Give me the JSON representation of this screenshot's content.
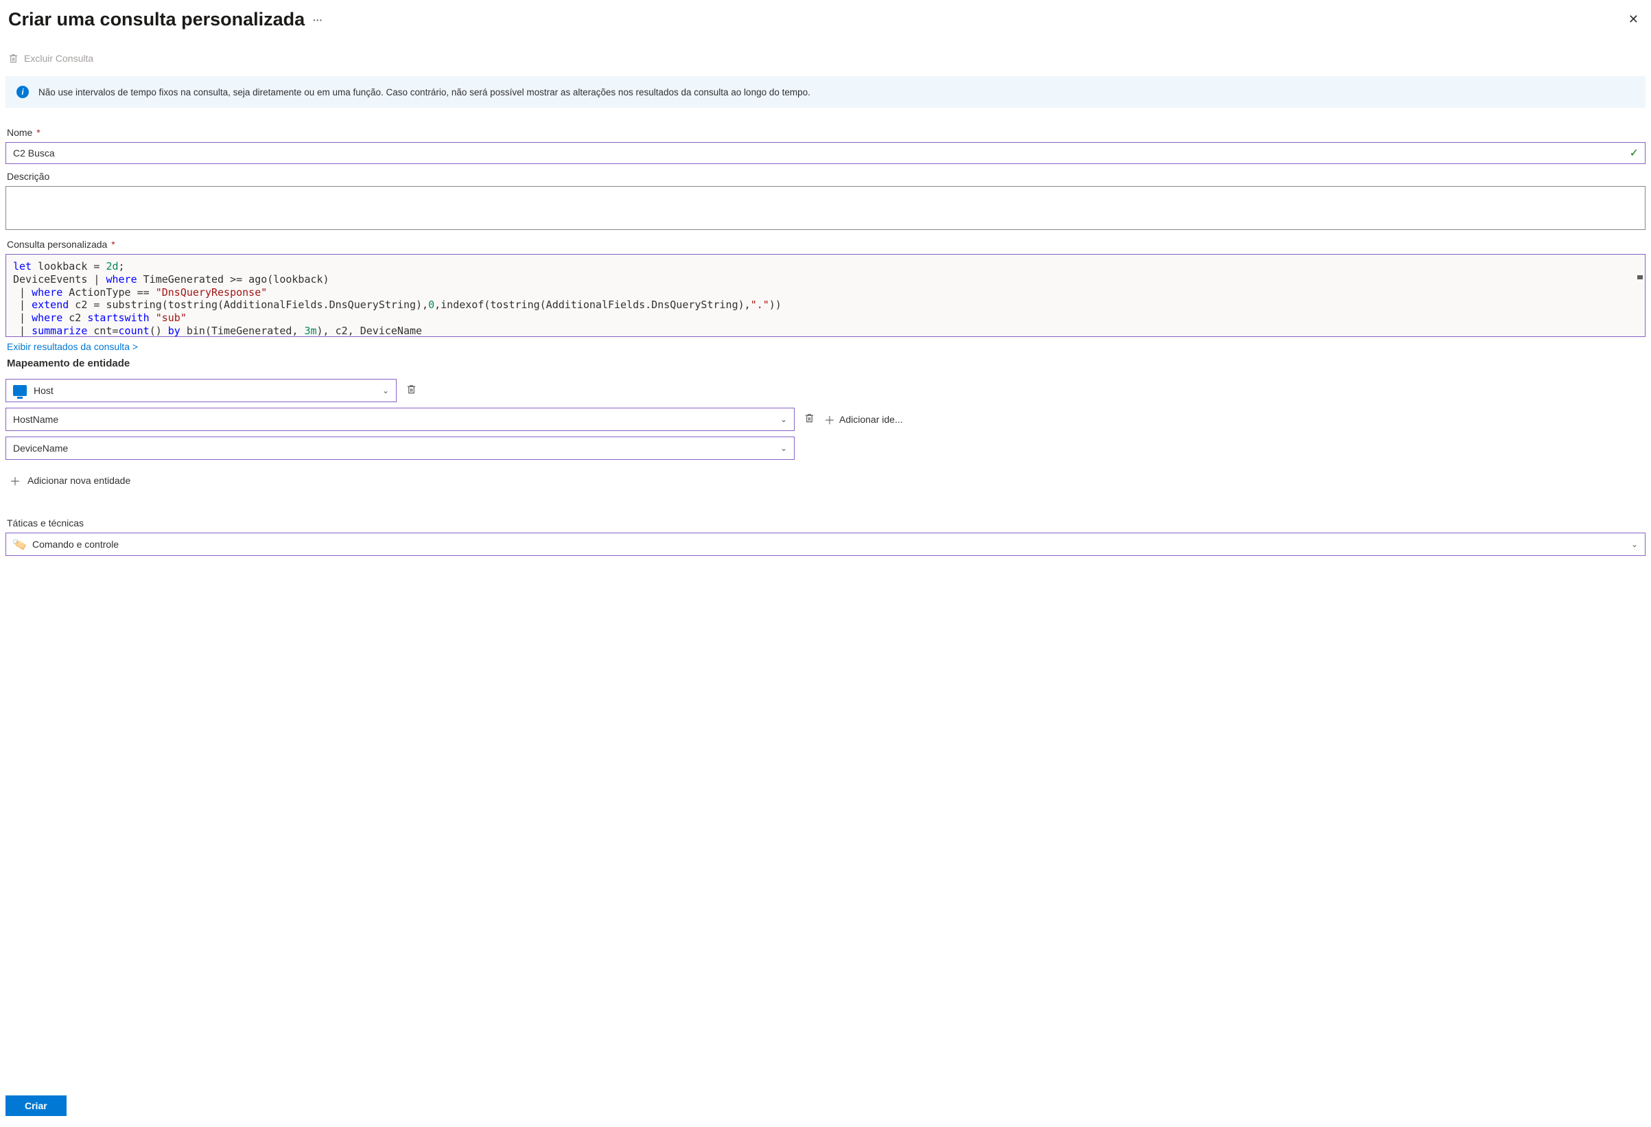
{
  "header": {
    "title": "Criar uma consulta personalizada",
    "more": "···"
  },
  "toolbar": {
    "delete_label": "Excluir Consulta"
  },
  "banner": {
    "text": "Não use intervalos de tempo fixos na consulta, seja diretamente ou em uma função. Caso contrário, não será possível mostrar as alterações nos resultados da consulta ao longo do tempo."
  },
  "fields": {
    "name_label": "Nome",
    "name_value": "C2 Busca",
    "description_label": "Descrição",
    "description_value": "",
    "custom_query_label": "Consulta personalizada",
    "view_results_link": "Exibir resultados da consulta >"
  },
  "code_tokens": {
    "l1a": "let",
    "l1b": " lookback = ",
    "l1c": "2d",
    "l1d": ";",
    "l2a": "DeviceEvents | ",
    "l2b": "where",
    "l2c": " TimeGenerated >= ago(lookback)",
    "l3a": " | ",
    "l3b": "where",
    "l3c": " ActionType == ",
    "l3d": "\"DnsQueryResponse\"",
    "l4a": " | ",
    "l4b": "extend",
    "l4c": " c2 = substring(tostring(AdditionalFields.DnsQueryString),",
    "l4d": "0",
    "l4e": ",indexof(tostring(AdditionalFields.DnsQueryString),",
    "l4f": "\".\"",
    "l4g": "))",
    "l5a": " | ",
    "l5b": "where",
    "l5c": " c2 ",
    "l5d": "startswith",
    "l5e": " ",
    "l5f": "\"sub\"",
    "l6a": " | ",
    "l6b": "summarize",
    "l6c": " cnt=",
    "l6d": "count",
    "l6e": "() ",
    "l6f": "by",
    "l6g": " bin(TimeGenerated, ",
    "l6h": "3m",
    "l6i": "), c2, DeviceName"
  },
  "entity_mapping": {
    "section_label": "Mapeamento de entidade",
    "entity_type": "Host",
    "identifier_key": "HostName",
    "identifier_value": "DeviceName",
    "add_identifier_label": "Adicionar ide...",
    "add_entity_label": "Adicionar nova entidade"
  },
  "tactics": {
    "label": "Táticas e técnicas",
    "selected": "Comando e controle"
  },
  "footer": {
    "create_label": "Criar"
  }
}
